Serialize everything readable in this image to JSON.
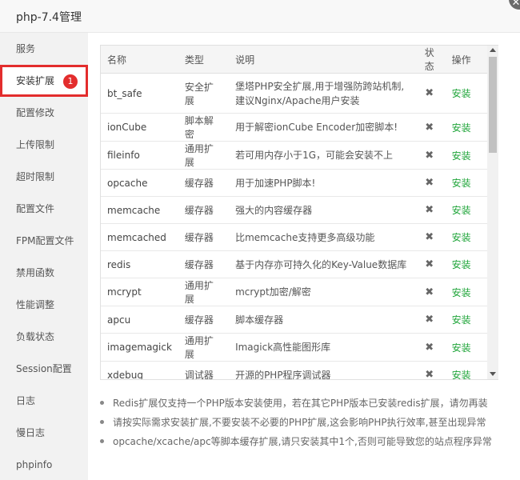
{
  "window": {
    "title": "php-7.4管理",
    "close_icon": "close-icon"
  },
  "sidebar": {
    "items": [
      {
        "label": "服务"
      },
      {
        "label": "安装扩展",
        "active": true,
        "badge": "1"
      },
      {
        "label": "配置修改"
      },
      {
        "label": "上传限制"
      },
      {
        "label": "超时限制"
      },
      {
        "label": "配置文件"
      },
      {
        "label": "FPM配置文件"
      },
      {
        "label": "禁用函数"
      },
      {
        "label": "性能调整"
      },
      {
        "label": "负载状态"
      },
      {
        "label": "Session配置"
      },
      {
        "label": "日志"
      },
      {
        "label": "慢日志"
      },
      {
        "label": "phpinfo"
      }
    ]
  },
  "table": {
    "headers": {
      "name": "名称",
      "type": "类型",
      "desc": "说明",
      "status": "状态",
      "op": "操作"
    },
    "rows": [
      {
        "name": "bt_safe",
        "type": "安全扩展",
        "desc": "堡塔PHP安全扩展,用于增强防跨站机制,建议Nginx/Apache用户安装",
        "status": "✖",
        "op": "安装"
      },
      {
        "name": "ionCube",
        "type": "脚本解密",
        "desc": "用于解密ionCube Encoder加密脚本!",
        "status": "✖",
        "op": "安装"
      },
      {
        "name": "fileinfo",
        "type": "通用扩展",
        "desc": "若可用内存小于1G，可能会安装不上",
        "status": "✖",
        "op": "安装"
      },
      {
        "name": "opcache",
        "type": "缓存器",
        "desc": "用于加速PHP脚本!",
        "status": "✖",
        "op": "安装"
      },
      {
        "name": "memcache",
        "type": "缓存器",
        "desc": "强大的内容缓存器",
        "status": "✖",
        "op": "安装"
      },
      {
        "name": "memcached",
        "type": "缓存器",
        "desc": "比memcache支持更多高级功能",
        "status": "✖",
        "op": "安装"
      },
      {
        "name": "redis",
        "type": "缓存器",
        "desc": "基于内存亦可持久化的Key-Value数据库",
        "status": "✖",
        "op": "安装"
      },
      {
        "name": "mcrypt",
        "type": "通用扩展",
        "desc": "mcrypt加密/解密",
        "status": "✖",
        "op": "安装"
      },
      {
        "name": "apcu",
        "type": "缓存器",
        "desc": "脚本缓存器",
        "status": "✖",
        "op": "安装"
      },
      {
        "name": "imagemagick",
        "type": "通用扩展",
        "desc": "Imagick高性能图形库",
        "status": "✖",
        "op": "安装"
      },
      {
        "name": "xdebug",
        "type": "调试器",
        "desc": "开源的PHP程序调试器",
        "status": "✖",
        "op": "安装"
      }
    ]
  },
  "notes": [
    "Redis扩展仅支持一个PHP版本安装使用，若在其它PHP版本已安装redis扩展，请勿再装",
    "请按实际需求安装扩展,不要安装不必要的PHP扩展,这会影响PHP执行效率,甚至出现异常",
    "opcache/xcache/apc等脚本缓存扩展,请只安装其中1个,否则可能导致您的站点程序异常"
  ],
  "colors": {
    "accent_red": "#e32d2d",
    "install_green": "#20a53a"
  }
}
